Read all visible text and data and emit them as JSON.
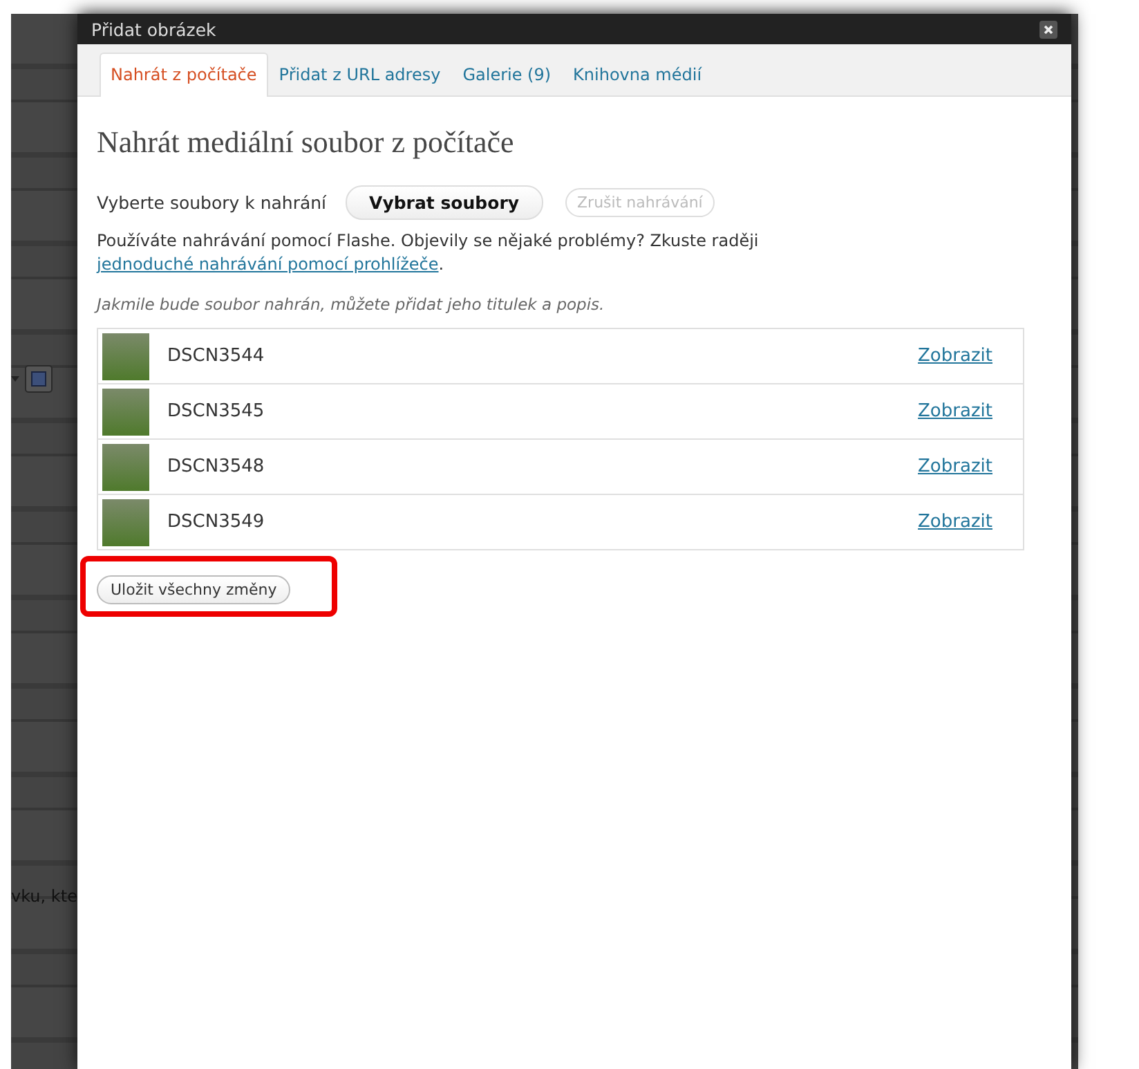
{
  "background_fragment": "vku, kte",
  "window": {
    "title": "Přidat obrázek"
  },
  "tabs": [
    {
      "label": "Nahrát z počítače",
      "selected": true
    },
    {
      "label": "Přidat z URL adresy",
      "selected": false
    },
    {
      "label": "Galerie (9)",
      "selected": false
    },
    {
      "label": "Knihovna médií",
      "selected": false
    }
  ],
  "heading": "Nahrát mediální soubor z počítače",
  "upload": {
    "label": "Vyberte soubory k nahrání",
    "select_button": "Vybrat soubory",
    "cancel_button": {
      "label": "Zrušit nahrávání",
      "disabled": true
    }
  },
  "flash_notice": {
    "text": "Používáte nahrávání pomocí Flashe. Objevily se nějaké problémy? Zkuste raději ",
    "link": "jednoduché nahrávání pomocí prohlížeče",
    "after": "."
  },
  "hint": "Jakmile bude soubor nahrán, můžete přidat jeho titulek a popis.",
  "files": [
    {
      "name": "DSCN3544",
      "action": "Zobrazit"
    },
    {
      "name": "DSCN3545",
      "action": "Zobrazit"
    },
    {
      "name": "DSCN3548",
      "action": "Zobrazit"
    },
    {
      "name": "DSCN3549",
      "action": "Zobrazit"
    }
  ],
  "save_button": {
    "label": "Uložit všechny změny",
    "highlighted": true
  }
}
